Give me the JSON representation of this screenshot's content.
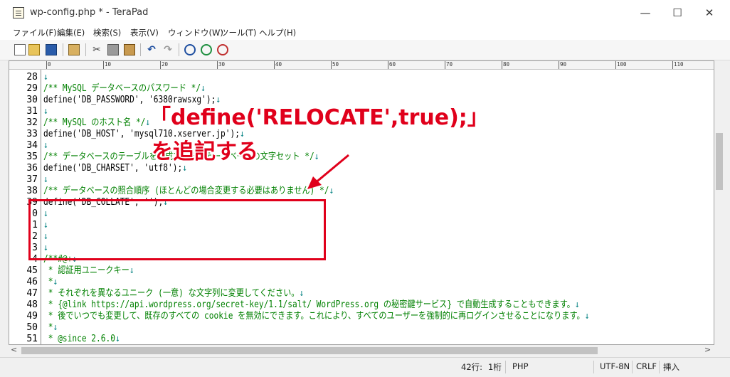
{
  "window": {
    "title": "wp-config.php * - TeraPad"
  },
  "menu": [
    "ファイル(F)",
    "編集(E)",
    "検索(S)",
    "表示(V)",
    "ウィンドウ(W)",
    "ツール(T)",
    "ヘルプ(H)"
  ],
  "toolbar_icons": [
    "new-file-icon",
    "open-file-icon",
    "save-icon",
    "print-icon",
    "cut-icon",
    "copy-icon",
    "paste-icon",
    "undo-icon",
    "redo-icon",
    "find-icon",
    "find-next-icon",
    "find-prev-icon"
  ],
  "ruler": [
    "0",
    "10",
    "20",
    "30",
    "40",
    "50",
    "60",
    "70",
    "80",
    "90",
    "100",
    "110"
  ],
  "lines": [
    {
      "num": "28",
      "text": "",
      "type": "normal"
    },
    {
      "num": "29",
      "text": "/** MySQL データベースのパスワード */",
      "type": "comment"
    },
    {
      "num": "30",
      "text": "define('DB_PASSWORD', '6380rawsxg');",
      "type": "normal"
    },
    {
      "num": "31",
      "text": "",
      "type": "normal"
    },
    {
      "num": "32",
      "text": "/** MySQL のホスト名 */",
      "type": "comment"
    },
    {
      "num": "33",
      "text": "define('DB_HOST', 'mysql710.xserver.jp');",
      "type": "normal"
    },
    {
      "num": "34",
      "text": "",
      "type": "normal"
    },
    {
      "num": "35",
      "text": "/** データベースのテーブルを作成する際のデータベースの文字セット */",
      "type": "comment"
    },
    {
      "num": "36",
      "text": "define('DB_CHARSET', 'utf8');",
      "type": "normal"
    },
    {
      "num": "37",
      "text": "",
      "type": "normal"
    },
    {
      "num": "38",
      "text": "/** データベースの照合順序 (ほとんどの場合変更する必要はありません) */",
      "type": "comment"
    },
    {
      "num": "39",
      "text": "define('DB_COLLATE', '');",
      "type": "normal"
    },
    {
      "num": "0",
      "text": "",
      "type": "normal"
    },
    {
      "num": "1",
      "text": "",
      "type": "normal"
    },
    {
      "num": "2",
      "text": "",
      "type": "normal"
    },
    {
      "num": "3",
      "text": "",
      "type": "normal"
    },
    {
      "num": "4",
      "text": "/**#@+",
      "type": "comment"
    },
    {
      "num": "45",
      "text": " * 認証用ユニークキー",
      "type": "comment"
    },
    {
      "num": "46",
      "text": " *",
      "type": "comment"
    },
    {
      "num": "47",
      "text": " * それぞれを異なるユニーク (一意) な文字列に変更してください。",
      "type": "comment"
    },
    {
      "num": "48",
      "text": " * {@link https://api.wordpress.org/secret-key/1.1/salt/ WordPress.org の秘密鍵サービス} で自動生成することもできます。",
      "type": "comment"
    },
    {
      "num": "49",
      "text": " * 後でいつでも変更して、既存のすべての cookie を無効にできます。これにより、すべてのユーザーを強制的に再ログインさせることになります。",
      "type": "comment"
    },
    {
      "num": "50",
      "text": " *",
      "type": "comment"
    },
    {
      "num": "51",
      "text": " * @since 2.6.0",
      "type": "comment"
    }
  ],
  "newline_glyph": "↓",
  "annotation": {
    "line1": "「define('RELOCATE',true);」",
    "line2": "を追記する"
  },
  "status": {
    "position": "42行:",
    "column": "1桁",
    "mode": "PHP",
    "encoding": "UTF-8N",
    "line_ending": "CRLF",
    "insert_mode": "挿入"
  },
  "colors": {
    "accent": "#e0001b",
    "comment": "#008000"
  }
}
